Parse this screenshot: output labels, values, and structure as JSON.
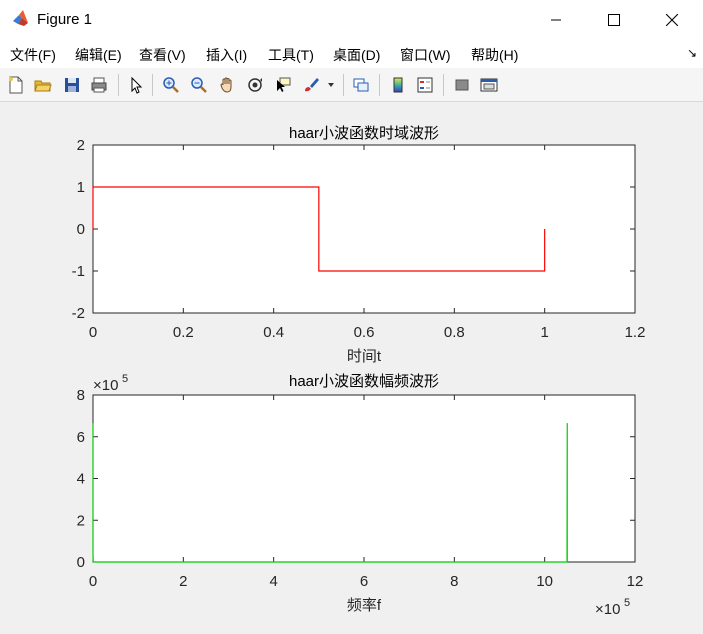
{
  "window": {
    "title": "Figure 1",
    "controls": [
      "minimize",
      "maximize",
      "close"
    ]
  },
  "menu": {
    "items": [
      "文件(F)",
      "编辑(E)",
      "查看(V)",
      "插入(I)",
      "工具(T)",
      "桌面(D)",
      "窗口(W)",
      "帮助(H)"
    ]
  },
  "toolbar": {
    "icons": [
      "new-figure-icon",
      "open-icon",
      "save-icon",
      "print-icon",
      "pointer-icon",
      "zoom-in-icon",
      "zoom-out-icon",
      "pan-hand-icon",
      "rotate-3d-icon",
      "data-cursor-icon",
      "brush-icon",
      "link-plot-icon",
      "colorbar-icon",
      "legend-icon",
      "hide-plot-tools-icon",
      "show-plot-tools-icon"
    ]
  },
  "colors": {
    "line1": "#ff0000",
    "line2": "#00cc00",
    "axes_bg": "#ffffff",
    "figure_bg": "#f0f0f0"
  },
  "chart_data": [
    {
      "type": "line",
      "title": "haar小波函数时域波形",
      "xlabel": "时间t",
      "ylabel": "",
      "xlim": [
        0,
        1.2
      ],
      "ylim": [
        -2,
        2
      ],
      "xticks": [
        "0",
        "0.2",
        "0.4",
        "0.6",
        "0.8",
        "1",
        "1.2"
      ],
      "yticks": [
        "-2",
        "-1",
        "0",
        "1",
        "2"
      ],
      "grid": false,
      "series": [
        {
          "x": [
            0,
            0,
            0.5,
            0.5,
            1,
            1
          ],
          "y": [
            0,
            1,
            1,
            -1,
            -1,
            0
          ]
        }
      ]
    },
    {
      "type": "line",
      "title": "haar小波函数幅频波形",
      "xlabel": "频率f",
      "ylabel": "",
      "xlim": [
        0,
        12
      ],
      "ylim": [
        0,
        8
      ],
      "x_multiplier": "×10",
      "x_exponent": "5",
      "y_multiplier": "×10",
      "y_exponent": "5",
      "xticks": [
        "0",
        "2",
        "4",
        "6",
        "8",
        "10",
        "12"
      ],
      "yticks": [
        "0",
        "2",
        "4",
        "6",
        "8"
      ],
      "grid": false,
      "series": [
        {
          "x": [
            0,
            0,
            0.005,
            10.45,
            10.495,
            10.5,
            10.5
          ],
          "y": [
            6.65,
            0.4,
            0,
            0,
            0,
            6.65,
            0
          ]
        }
      ]
    }
  ]
}
